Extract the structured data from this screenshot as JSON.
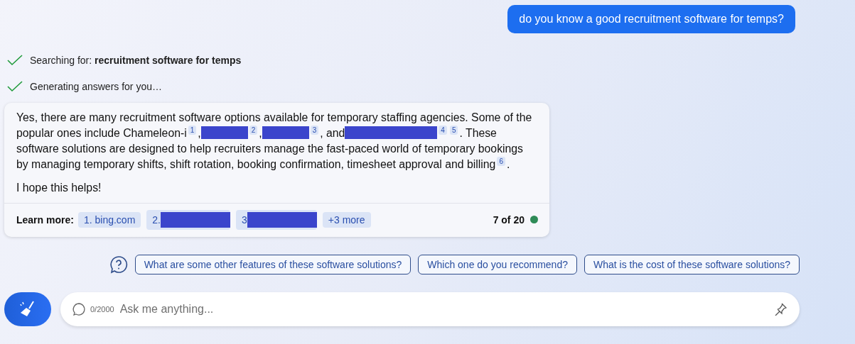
{
  "user_message": "do you know a good recruitment software for temps?",
  "progress": [
    {
      "label": "Searching for: ",
      "query": "recruitment software for temps",
      "done": true
    },
    {
      "label": "Generating answers for you…",
      "done": true
    }
  ],
  "answer": {
    "paragraphs": [
      [
        {
          "kind": "text",
          "text": "Yes, there are many recruitment software options available for temporary staffing agencies. Some of the popular ones include Chameleon-i"
        },
        {
          "kind": "cite",
          "text": "1"
        },
        {
          "kind": "text",
          "text": ","
        },
        {
          "kind": "redacted",
          "wide": false
        },
        {
          "kind": "cite",
          "text": "2"
        },
        {
          "kind": "text",
          "text": ","
        },
        {
          "kind": "redacted",
          "wide": false
        },
        {
          "kind": "cite",
          "text": "3"
        },
        {
          "kind": "text",
          "text": ", and"
        },
        {
          "kind": "redacted",
          "wide": true
        },
        {
          "kind": "cite",
          "text": "4"
        },
        {
          "kind": "cite",
          "text": "5"
        },
        {
          "kind": "text",
          "text": ". These software solutions are designed to help recruiters manage the fast-paced world of temporary bookings by managing temporary shifts, shift rotation, booking confirmation, timesheet approval and billing"
        },
        {
          "kind": "cite",
          "text": "6"
        },
        {
          "kind": "text",
          "text": "."
        }
      ],
      [
        {
          "kind": "text",
          "text": "I hope this helps!"
        }
      ]
    ],
    "learn_more": {
      "label": "Learn more:",
      "links": [
        {
          "text": "1. bing.com",
          "redacted": false
        },
        {
          "text": "2.",
          "redacted": true
        },
        {
          "text": "3",
          "redacted": true
        },
        {
          "text": "+3 more",
          "redacted": false
        }
      ]
    },
    "counter": "7 of 20",
    "status": {
      "color": "#2e8b57"
    }
  },
  "suggestions": [
    "What are some other features of these software solutions?",
    "Which one do you recommend?",
    "What is the cost of these software solutions?"
  ],
  "input": {
    "placeholder": "Ask me anything...",
    "char_count": "0/2000"
  }
}
